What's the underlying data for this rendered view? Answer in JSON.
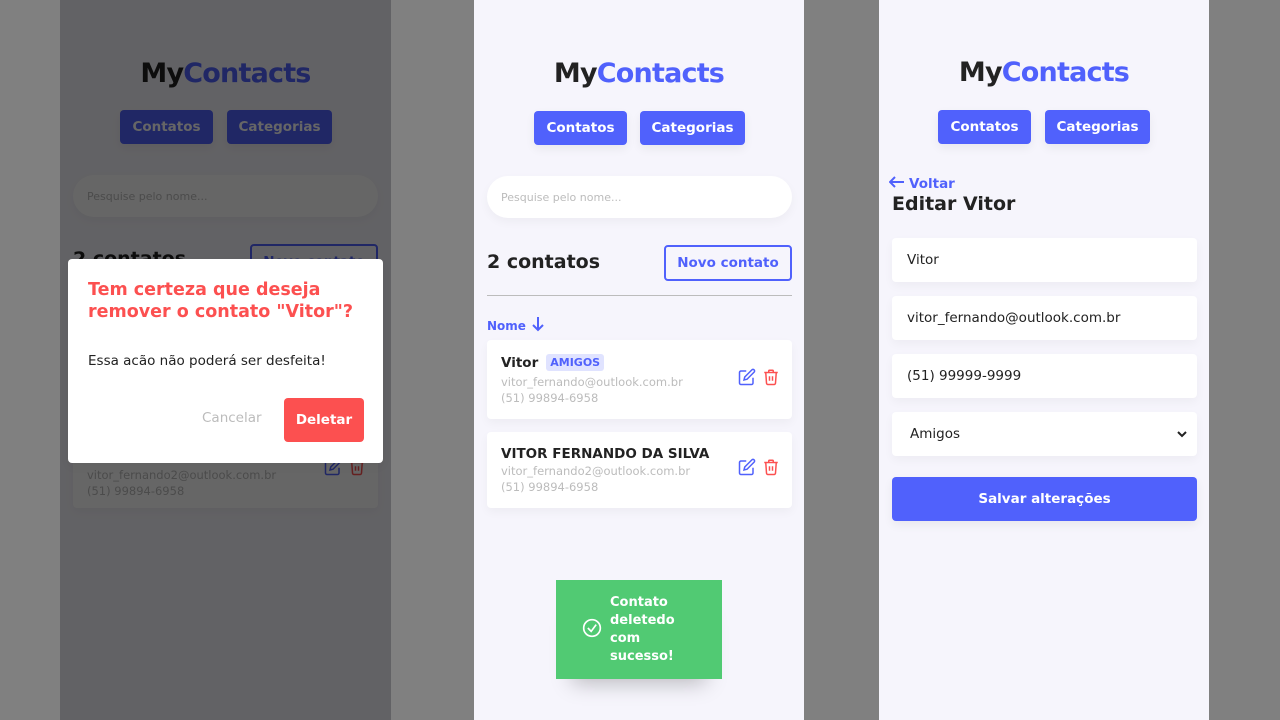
{
  "app": {
    "logo_part1": "My",
    "logo_part2": "Contacts"
  },
  "nav": {
    "contacts_label": "Contatos",
    "categories_label": "Categorias"
  },
  "list_screen": {
    "search_placeholder": "Pesquise pelo nome...",
    "count_title": "2 contatos",
    "new_contact_label": "Novo contato",
    "sort_label": "Nome",
    "contacts": [
      {
        "name": "Vitor",
        "category": "AMIGOS",
        "email": "vitor_fernando@outlook.com.br",
        "phone": "(51) 99894-6958"
      },
      {
        "name": "VITOR FERNANDO DA SILVA",
        "category": "",
        "email": "vitor_fernando2@outlook.com.br",
        "phone": "(51) 99894-6958"
      }
    ],
    "toast_text": "Contato deletedo com sucesso!"
  },
  "edit_screen": {
    "back_label": "Voltar",
    "title": "Editar Vitor",
    "name_value": "Vitor",
    "email_value": "vitor_fernando@outlook.com.br",
    "phone_value": "(51) 99999-9999",
    "category_value": "Amigos",
    "save_label": "Salvar alterações"
  },
  "delete_modal": {
    "title": "Tem certeza que deseja remover o contato \"Vitor\"?",
    "body": "Essa acão não poderá ser desfeita!",
    "cancel_label": "Cancelar",
    "delete_label": "Deletar"
  },
  "colors": {
    "primary": "#5061fc",
    "danger": "#fc5050",
    "success": "#51ca73",
    "background": "#f6f5fc",
    "text": "#222222",
    "muted": "#bcbcbc"
  }
}
